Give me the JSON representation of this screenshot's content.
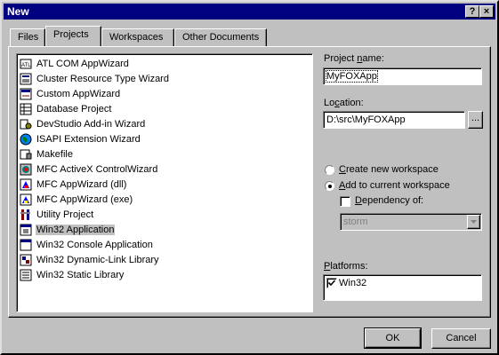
{
  "window": {
    "title": "New",
    "help_btn": "?",
    "close_btn": "×"
  },
  "tabs": [
    {
      "label": "Files"
    },
    {
      "label": "Projects"
    },
    {
      "label": "Workspaces"
    },
    {
      "label": "Other Documents"
    }
  ],
  "project_types": [
    {
      "label": "ATL COM AppWizard",
      "icon": "atl-icon"
    },
    {
      "label": "Cluster Resource Type Wizard",
      "icon": "cluster-icon"
    },
    {
      "label": "Custom AppWizard",
      "icon": "custom-wizard-icon"
    },
    {
      "label": "Database Project",
      "icon": "database-icon"
    },
    {
      "label": "DevStudio Add-in Wizard",
      "icon": "addin-icon"
    },
    {
      "label": "ISAPI Extension Wizard",
      "icon": "globe-icon"
    },
    {
      "label": "Makefile",
      "icon": "makefile-icon"
    },
    {
      "label": "MFC ActiveX ControlWizard",
      "icon": "activex-icon"
    },
    {
      "label": "MFC AppWizard (dll)",
      "icon": "mfc-dll-icon"
    },
    {
      "label": "MFC AppWizard (exe)",
      "icon": "mfc-exe-icon"
    },
    {
      "label": "Utility Project",
      "icon": "utility-icon"
    },
    {
      "label": "Win32 Application",
      "icon": "win32-app-icon"
    },
    {
      "label": "Win32 Console Application",
      "icon": "console-icon"
    },
    {
      "label": "Win32 Dynamic-Link Library",
      "icon": "dll-icon"
    },
    {
      "label": "Win32 Static Library",
      "icon": "lib-icon"
    }
  ],
  "selected_index": 11,
  "project_name": {
    "label_pre": "Project ",
    "label_u": "n",
    "label_post": "ame:",
    "value": "MyFOXApp"
  },
  "location": {
    "label_pre": "Lo",
    "label_u": "c",
    "label_post": "ation:",
    "value": "D:\\src\\MyFOXApp",
    "browse": "..."
  },
  "workspace": {
    "create_pre": "",
    "create_u": "C",
    "create_post": "reate new workspace",
    "add_pre": "",
    "add_u": "A",
    "add_post": "dd to current workspace",
    "selected": "add",
    "dependency_pre": "",
    "dependency_u": "D",
    "dependency_post": "ependency of:",
    "dependency_checked": false,
    "dependency_value": "storm"
  },
  "platforms": {
    "label_pre": "",
    "label_u": "P",
    "label_post": "latforms:",
    "items": [
      {
        "label": "Win32",
        "checked": true
      }
    ]
  },
  "buttons": {
    "ok": "OK",
    "cancel": "Cancel"
  }
}
